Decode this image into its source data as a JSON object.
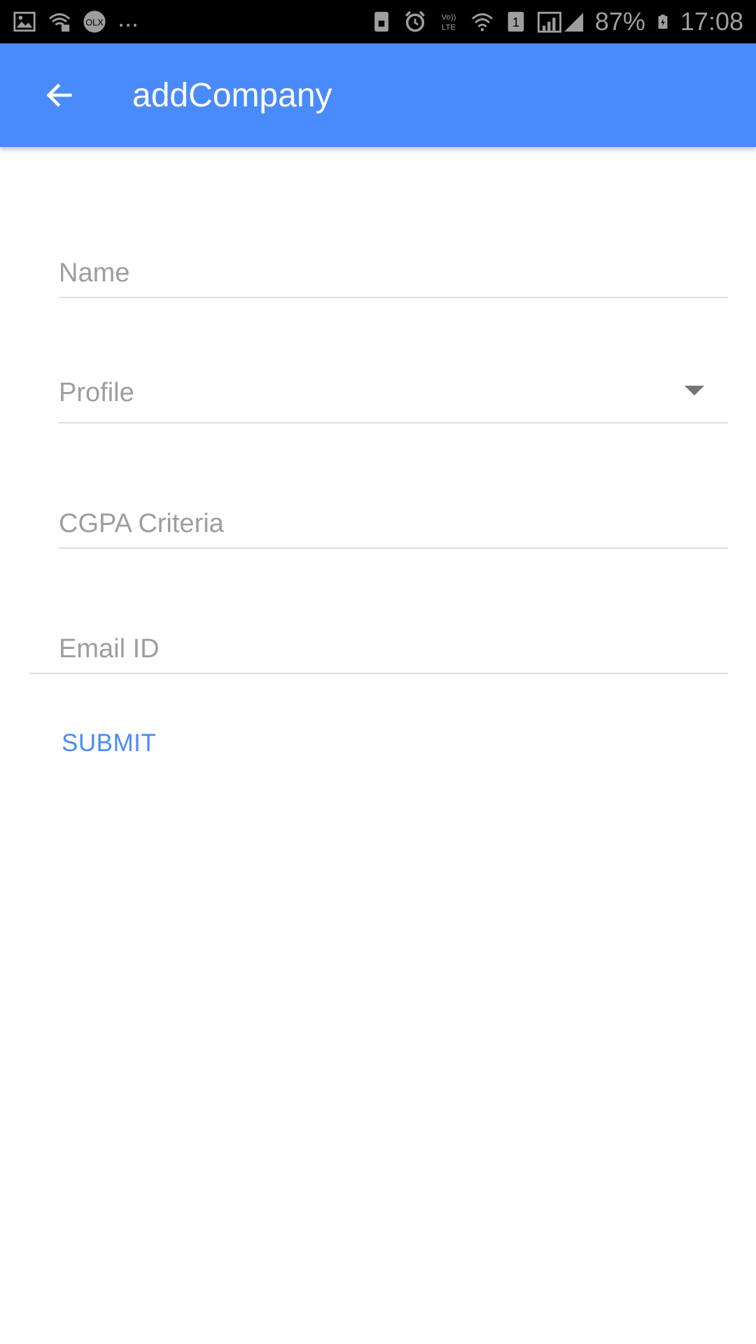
{
  "status_bar": {
    "left_icons": [
      "gallery-icon",
      "wifi-lock-icon",
      "olx-icon"
    ],
    "overflow_dots": "...",
    "right_icons": [
      "lock-icon",
      "alarm-icon",
      "volte-icon",
      "wifi-icon",
      "sim-icon",
      "signal-icon"
    ],
    "volte_label": "Vo)) LTE",
    "sim_number": "1",
    "battery": "87%",
    "time": "17:08"
  },
  "app_bar": {
    "title": "addCompany",
    "color": "#4a8bfc"
  },
  "form": {
    "name_placeholder": "Name",
    "profile_label": "Profile",
    "cgpa_placeholder": "CGPA Criteria",
    "email_placeholder": "Email ID",
    "submit_label": "SUBMIT"
  }
}
